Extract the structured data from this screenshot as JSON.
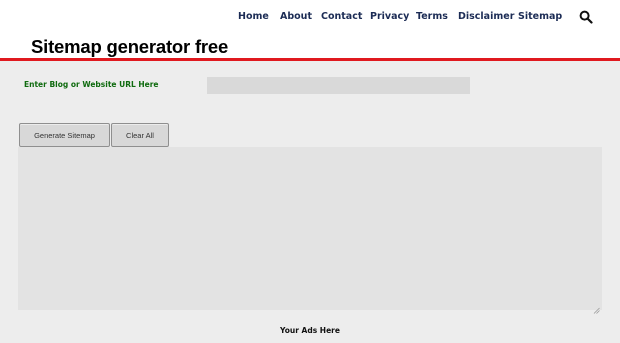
{
  "nav": {
    "items": [
      {
        "label": "Home"
      },
      {
        "label": "About"
      },
      {
        "label": "Contact"
      },
      {
        "label": "Privacy"
      },
      {
        "label": "Terms"
      },
      {
        "label": "Disclaimer"
      },
      {
        "label": "Sitemap"
      }
    ],
    "search_icon": "search-icon"
  },
  "page": {
    "title": "Sitemap generator free"
  },
  "form": {
    "url_label": "Enter Blog or Website URL Here",
    "url_value": "",
    "generate_label": "Generate Sitemap",
    "clear_label": "Clear All",
    "output_value": ""
  },
  "footer": {
    "ads_text": "Your Ads Here"
  },
  "colors": {
    "accent_rule": "#e0191f",
    "nav_text": "#1c2c55",
    "label_green": "#0f6b0f"
  }
}
